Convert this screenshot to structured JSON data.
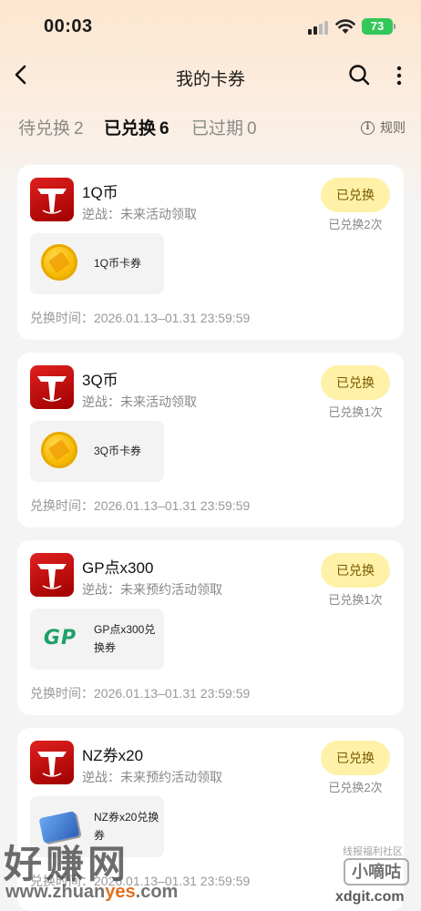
{
  "status_bar": {
    "time": "00:03",
    "battery": "73"
  },
  "header": {
    "title": "我的卡券"
  },
  "tabs": [
    {
      "label": "待兑换",
      "count": "2"
    },
    {
      "label": "已兑换",
      "count": "6"
    },
    {
      "label": "已过期",
      "count": "0"
    }
  ],
  "rules_label": "规则",
  "cards": [
    {
      "title": "1Q币",
      "source": "逆战：未来活动领取",
      "button": "已兑换",
      "redeem_count": "已兑换2次",
      "voucher_icon": "q-coin-icon",
      "voucher_name": "1Q币卡券",
      "time": "兑换时间：2026.01.13–01.31 23:59:59"
    },
    {
      "title": "3Q币",
      "source": "逆战：未来活动领取",
      "button": "已兑换",
      "redeem_count": "已兑换1次",
      "voucher_icon": "q-coin-icon",
      "voucher_name": "3Q币卡券",
      "time": "兑换时间：2026.01.13–01.31 23:59:59"
    },
    {
      "title": "GP点x300",
      "source": "逆战：未来预约活动领取",
      "button": "已兑换",
      "redeem_count": "已兑换1次",
      "voucher_icon": "gp-icon",
      "voucher_icon_text": "GP",
      "voucher_name": "GP点x300兑换券",
      "time": "兑换时间：2026.01.13–01.31 23:59:59"
    },
    {
      "title": "NZ券x20",
      "source": "逆战：未来预约活动领取",
      "button": "已兑换",
      "redeem_count": "已兑换2次",
      "voucher_icon": "nz-ticket-icon",
      "voucher_name": "NZ券x20兑换券",
      "time": "兑换时间：2026.01.13–01.31 23:59:59"
    }
  ],
  "watermark": {
    "left_text": "好赚网",
    "left_url_prefix": "www.zhuan",
    "left_url_highlight": "yes",
    "left_url_suffix": ".com",
    "right_small": "线报福利社区",
    "right_box": "小嘀咕",
    "right_url": "xdgit.com"
  },
  "colors": {
    "accent_yellow": "#ffd740",
    "button_bg": "#fff1a8",
    "game_icon_red": "#d01818"
  }
}
